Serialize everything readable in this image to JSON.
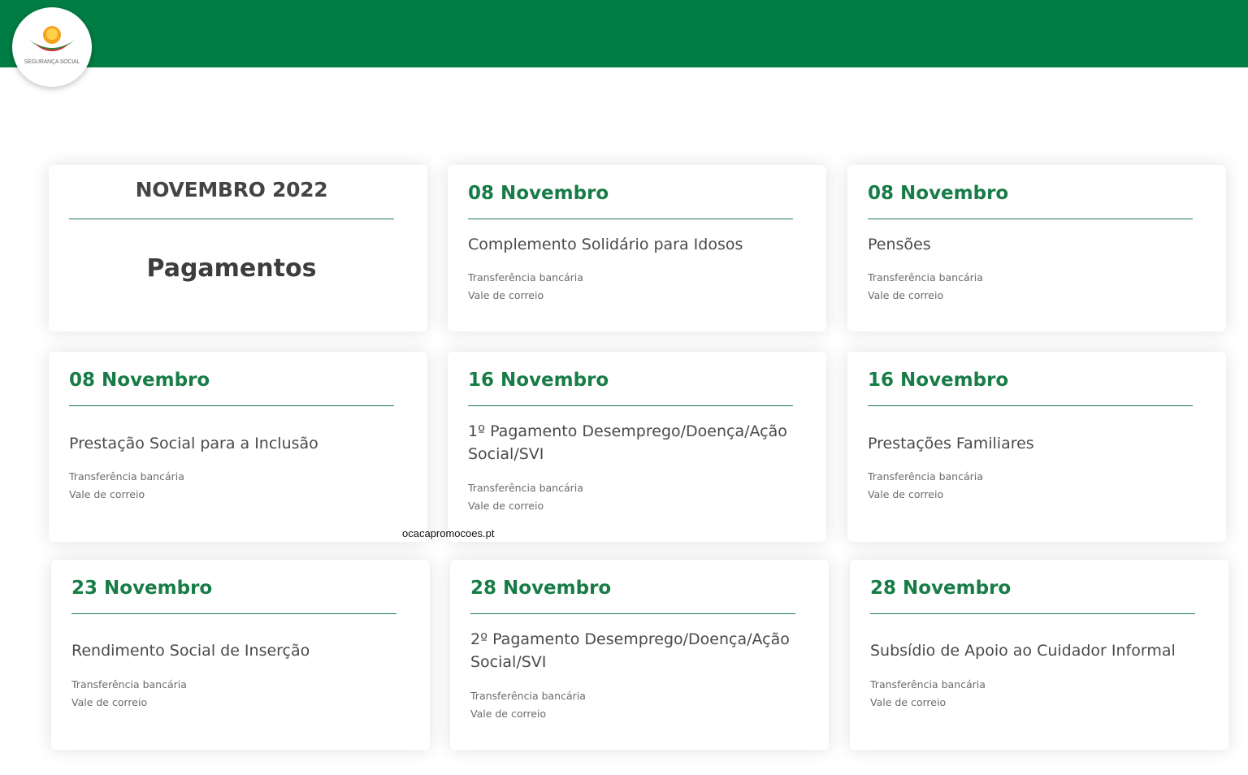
{
  "header": {
    "logo_text": "SEGURANÇA SOCIAL",
    "brand_color": "#007d44"
  },
  "intro": {
    "month": "NOVEMBRO 2022",
    "heading": "Pagamentos"
  },
  "payments": [
    {
      "date": "08 Novembro",
      "title": "Complemento Solidário para Idosos",
      "methods": [
        "Transferência bancária",
        "Vale de correio"
      ]
    },
    {
      "date": "08 Novembro",
      "title": "Pensões",
      "methods": [
        "Transferência bancária",
        "Vale de correio"
      ]
    },
    {
      "date": "08 Novembro",
      "title": "Prestação Social para a Inclusão",
      "methods": [
        "Transferência bancária",
        "Vale de correio"
      ]
    },
    {
      "date": "16 Novembro",
      "title": "1º Pagamento Desemprego/Doença/Ação Social/SVI",
      "methods": [
        "Transferência bancária",
        "Vale de correio"
      ]
    },
    {
      "date": "16 Novembro",
      "title": "Prestações Familiares",
      "methods": [
        "Transferência bancária",
        "Vale de correio"
      ]
    },
    {
      "date": "23 Novembro",
      "title": "Rendimento Social de Inserção",
      "methods": [
        "Transferência bancária",
        "Vale de correio"
      ]
    },
    {
      "date": "28 Novembro",
      "title": "2º Pagamento Desemprego/Doença/Ação Social/SVI",
      "methods": [
        "Transferência bancária",
        "Vale de correio"
      ]
    },
    {
      "date": "28 Novembro",
      "title": "Subsídio de Apoio ao Cuidador Informal",
      "methods": [
        "Transferência bancária",
        "Vale de correio"
      ]
    }
  ],
  "watermark": "ocacapromocoes.pt"
}
